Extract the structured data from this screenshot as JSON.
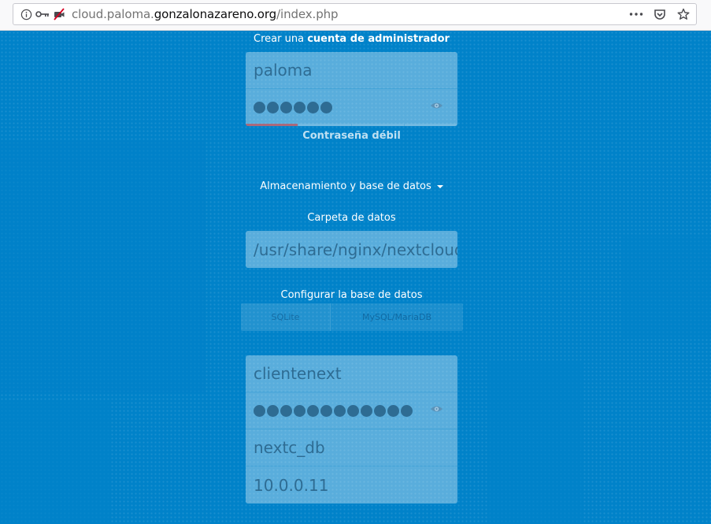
{
  "browser": {
    "url_prefix": "cloud.paloma.",
    "url_domain": "gonzalonazareno.org",
    "url_path": "/index.php"
  },
  "admin": {
    "heading_prefix": "Crear una",
    "heading_bold": "cuenta de administrador",
    "username": "paloma",
    "password_length": 6,
    "strength_label": "Contraseña débil"
  },
  "storage": {
    "toggle_label": "Almacenamiento y base de datos",
    "data_folder_label": "Carpeta de datos",
    "data_folder": "/usr/share/nginx/nextcloud"
  },
  "database": {
    "heading": "Configurar la base de datos",
    "options": [
      "SQLite",
      "MySQL/MariaDB"
    ],
    "user": "clientenext",
    "password_length": 12,
    "name": "nextc_db",
    "host": "10.0.0.11"
  }
}
